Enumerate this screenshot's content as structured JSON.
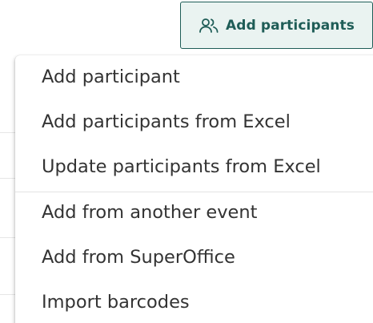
{
  "header": {
    "add_participants_label": "Add participants",
    "icon": "users-icon",
    "accent_color": "#1f5d57",
    "button_bg": "#eaf3f1"
  },
  "menu": {
    "items": [
      {
        "label": "Add participant"
      },
      {
        "label": "Add participants from Excel"
      },
      {
        "label": "Update participants from Excel"
      },
      {
        "label": "Add from another event"
      },
      {
        "label": "Add from SuperOffice"
      },
      {
        "label": "Import barcodes"
      }
    ]
  }
}
